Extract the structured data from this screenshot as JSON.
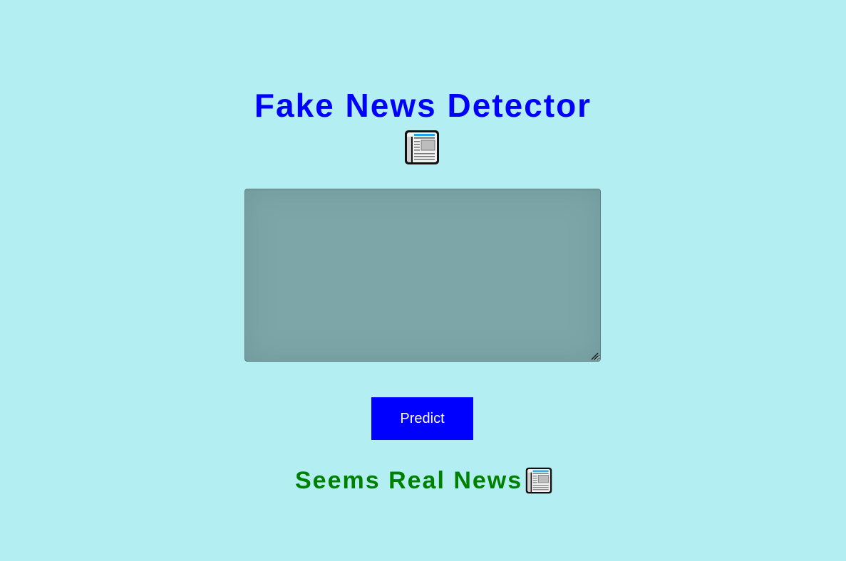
{
  "page": {
    "title": "Fake News Detector",
    "title_icon": "newspaper-icon"
  },
  "form": {
    "news_text_value": "",
    "news_text_placeholder": "",
    "predict_label": "Predict"
  },
  "result": {
    "text": "Seems Real News",
    "icon": "newspaper-icon"
  },
  "colors": {
    "background": "#b3eff2",
    "title": "#0000ff",
    "button": "#0000ff",
    "result": "#008000",
    "textarea": "#7da6a8"
  }
}
